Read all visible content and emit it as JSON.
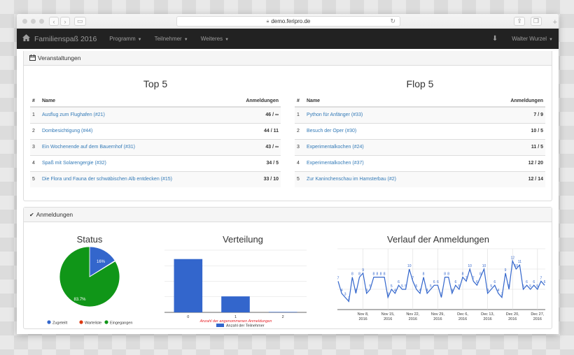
{
  "browser": {
    "url": "demo.feripro.de",
    "icons": [
      "back-icon",
      "forward-icon",
      "sidebar-icon",
      "lock-icon",
      "reload-icon",
      "share-icon",
      "tabs-icon",
      "new-tab-icon"
    ]
  },
  "navbar": {
    "brand": "Familienspaß 2016",
    "items": [
      {
        "label": "Programm"
      },
      {
        "label": "Teilnehmer"
      },
      {
        "label": "Weiteres"
      }
    ],
    "user": "Walter Wurzel"
  },
  "veranstaltungen": {
    "heading": "Veranstaltungen",
    "top": {
      "title": "Top 5",
      "headers": {
        "idx": "#",
        "name": "Name",
        "count": "Anmeldungen"
      },
      "rows": [
        {
          "idx": "1",
          "name": "Ausflug zum Flughafen (#21)",
          "count": "46 / ∞"
        },
        {
          "idx": "2",
          "name": "Dombesichtigung (#44)",
          "count": "44 / 11"
        },
        {
          "idx": "3",
          "name": "Ein Wochenende auf dem Bauernhof (#31)",
          "count": "43 / ∞"
        },
        {
          "idx": "4",
          "name": "Spaß mit Solarengergie (#32)",
          "count": "34 / 5"
        },
        {
          "idx": "5",
          "name": "Die Flora und Fauna der schwäbischen Alb entdecken (#15)",
          "count": "33 / 10"
        }
      ]
    },
    "flop": {
      "title": "Flop 5",
      "headers": {
        "idx": "#",
        "name": "Name",
        "count": "Anmeldungen"
      },
      "rows": [
        {
          "idx": "1",
          "name": "Python für Anfänger (#33)",
          "count": "7 / 9"
        },
        {
          "idx": "2",
          "name": "Besuch der Oper (#30)",
          "count": "10 / 5"
        },
        {
          "idx": "3",
          "name": "Experimentalkochen (#24)",
          "count": "11 / 5"
        },
        {
          "idx": "4",
          "name": "Experimentalkochen (#37)",
          "count": "12 / 20"
        },
        {
          "idx": "5",
          "name": "Zur Kaninchenschau im Hamsterbau (#2)",
          "count": "12 / 14"
        }
      ]
    }
  },
  "anmeldungen": {
    "heading": "Anmeldungen"
  },
  "chart_data": [
    {
      "type": "pie",
      "title": "Status",
      "labels": [
        "Zugeteilt",
        "Warteliste",
        "Eingegangen"
      ],
      "values": [
        16.0,
        0.3,
        83.7
      ],
      "slice_labels": [
        "16%",
        "",
        "83.7%"
      ],
      "colors": [
        "#3366cc",
        "#dc3912",
        "#109618"
      ],
      "legend": "bottom"
    },
    {
      "type": "bar",
      "title": "Verteilung",
      "categories": [
        "0",
        "1",
        "2"
      ],
      "series": [
        {
          "name": "Anzahl der Teilnehmer",
          "values": [
            120,
            36,
            1
          ],
          "color": "#3366cc"
        }
      ],
      "xlabel": "Anzahl der angenommenen Anmeldungen",
      "xlabel_color": "#e8262b",
      "ylim": [
        0,
        140
      ],
      "grid": true,
      "legend": "bottom"
    },
    {
      "type": "line",
      "title": "Verlauf der Anmeldungen",
      "x_ticks": [
        "Nov 8, 2016",
        "Nov 15, 2016",
        "Nov 22, 2016",
        "Nov 29, 2016",
        "Dec 6, 2016",
        "Dec 13, 2016",
        "Dec 20, 2016",
        "Dec 27, 2016"
      ],
      "values": [
        7,
        4,
        3,
        2,
        8,
        4,
        8,
        9,
        4,
        5,
        8,
        8,
        8,
        8,
        3,
        5,
        4,
        6,
        5,
        5,
        10,
        7,
        5,
        4,
        8,
        4,
        5,
        6,
        6,
        3,
        8,
        8,
        4,
        6,
        5,
        8,
        7,
        10,
        7,
        6,
        8,
        10,
        4,
        5,
        6,
        4,
        3,
        9,
        5,
        12,
        10,
        11,
        5,
        6,
        5,
        6,
        5,
        7,
        6
      ],
      "ylim": [
        0,
        15
      ],
      "color": "#3366cc",
      "grid": true,
      "legend": "none"
    }
  ]
}
